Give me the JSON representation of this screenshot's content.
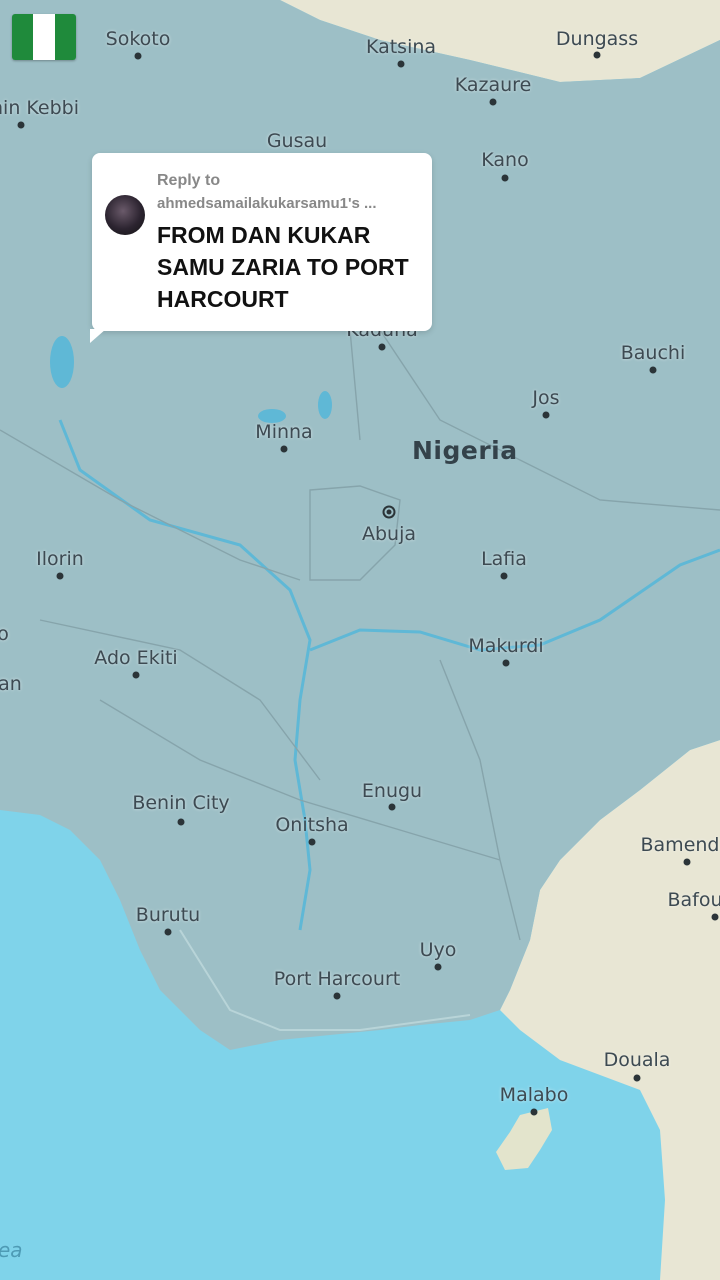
{
  "map": {
    "country": "Nigeria",
    "sea_partial": "ea",
    "colors": {
      "ocean": "#7fd3ea",
      "nigeria": "#9dbfc6",
      "neighbors": "#e8e6d4",
      "river": "#5fb8d6"
    },
    "cities": [
      {
        "key": "sokoto",
        "name": "Sokoto",
        "type": "city"
      },
      {
        "key": "katsina",
        "name": "Katsina",
        "type": "city"
      },
      {
        "key": "dungass",
        "name": "Dungass",
        "type": "city"
      },
      {
        "key": "birnin-kebbi",
        "name": "nin Kebbi",
        "type": "city"
      },
      {
        "key": "kazaure",
        "name": "Kazaure",
        "type": "city"
      },
      {
        "key": "gusau",
        "name": "Gusau",
        "type": "city"
      },
      {
        "key": "kano",
        "name": "Kano",
        "type": "city"
      },
      {
        "key": "kaduna",
        "name": "Kaduna",
        "type": "city"
      },
      {
        "key": "bauchi",
        "name": "Bauchi",
        "type": "city"
      },
      {
        "key": "jos",
        "name": "Jos",
        "type": "city"
      },
      {
        "key": "minna",
        "name": "Minna",
        "type": "city"
      },
      {
        "key": "abuja",
        "name": "Abuja",
        "type": "capital"
      },
      {
        "key": "lafia",
        "name": "Lafia",
        "type": "city"
      },
      {
        "key": "ilorin",
        "name": "Ilorin",
        "type": "city"
      },
      {
        "key": "makurdi",
        "name": "Makurdi",
        "type": "city"
      },
      {
        "key": "ado-ekiti",
        "name": "Ado Ekiti",
        "type": "city"
      },
      {
        "key": "ibadan",
        "name": "an",
        "type": "city"
      },
      {
        "key": "oyo",
        "name": "o",
        "type": "city"
      },
      {
        "key": "benin-city",
        "name": "Benin City",
        "type": "city"
      },
      {
        "key": "enugu",
        "name": "Enugu",
        "type": "city"
      },
      {
        "key": "onitsha",
        "name": "Onitsha",
        "type": "city"
      },
      {
        "key": "bamenda",
        "name": "Bamend",
        "type": "city"
      },
      {
        "key": "bafoussam",
        "name": "Bafou",
        "type": "city"
      },
      {
        "key": "burutu",
        "name": "Burutu",
        "type": "city"
      },
      {
        "key": "uyo",
        "name": "Uyo",
        "type": "city"
      },
      {
        "key": "port-harcourt",
        "name": "Port Harcourt",
        "type": "city"
      },
      {
        "key": "douala",
        "name": "Douala",
        "type": "city"
      },
      {
        "key": "malabo",
        "name": "Malabo",
        "type": "city"
      }
    ]
  },
  "overlay": {
    "flag_icon": "nigeria-flag-icon",
    "reply": {
      "heading": "Reply to",
      "username": "ahmedsamailakukarsamu1's ...",
      "text": "FROM DAN KUKAR SAMU ZARIA TO PORT HARCOURT"
    }
  }
}
